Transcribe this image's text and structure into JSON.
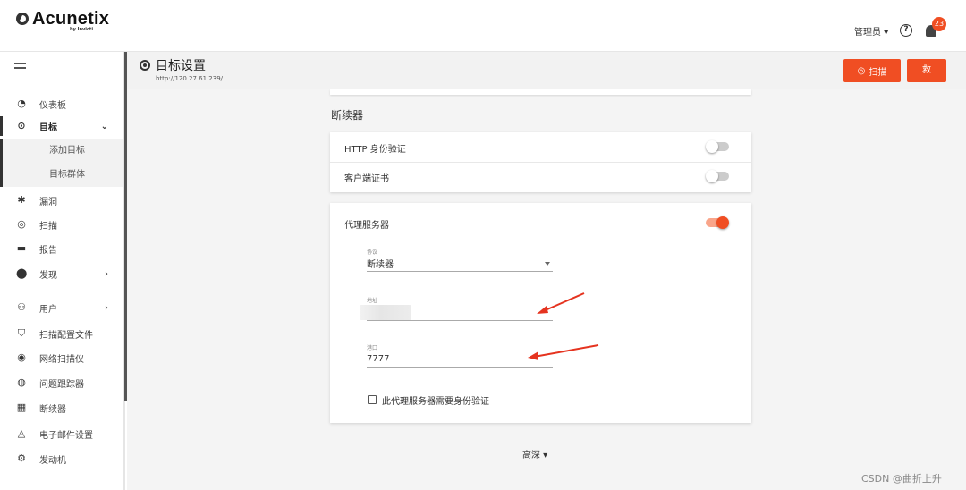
{
  "brand": {
    "name": "Acunetix",
    "sub": "by Invicti"
  },
  "header": {
    "user_label": "管理员 ▾",
    "help": "?",
    "notification_count": "23"
  },
  "sidebar": {
    "items": [
      {
        "label": "仪表板",
        "icon": "dashboard-icon",
        "glyph": "◔"
      },
      {
        "label": "目标",
        "icon": "target-icon",
        "glyph": "⊙",
        "chevron": "⌄"
      },
      {
        "label": "漏洞",
        "icon": "bug-icon",
        "glyph": "✱"
      },
      {
        "label": "扫描",
        "icon": "scan-icon",
        "glyph": "◎"
      },
      {
        "label": "报告",
        "icon": "report-icon",
        "glyph": "▬"
      },
      {
        "label": "发现",
        "icon": "compass-icon",
        "glyph": "⬤",
        "chevron": "›"
      },
      {
        "label": "用户",
        "icon": "users-icon",
        "glyph": "⚇",
        "chevron": "›"
      },
      {
        "label": "扫描配置文件",
        "icon": "shield-icon",
        "glyph": "⛉"
      },
      {
        "label": "网络扫描仪",
        "icon": "network-scanner-icon",
        "glyph": "◉"
      },
      {
        "label": "问题跟踪器",
        "icon": "issue-tracker-icon",
        "glyph": "◍"
      },
      {
        "label": "断续器",
        "icon": "proxy-icon",
        "glyph": "▦"
      },
      {
        "label": "电子邮件设置",
        "icon": "bell-icon",
        "glyph": "◬"
      },
      {
        "label": "发动机",
        "icon": "engine-icon",
        "glyph": "⚙"
      }
    ],
    "sub_items": [
      {
        "label": "添加目标"
      },
      {
        "label": "目标群体"
      }
    ]
  },
  "page": {
    "title": "目标设置",
    "url": "http://120.27.61.239/",
    "scan_button": "扫描",
    "save_button": "救"
  },
  "settings": {
    "section_title": "断续器",
    "http_auth_label": "HTTP 身份验证",
    "http_auth_enabled": false,
    "client_cert_label": "客户端证书",
    "client_cert_enabled": false,
    "proxy_label": "代理服务器",
    "proxy_enabled": true,
    "protocol_label": "协议",
    "protocol_value": "断续器",
    "address_label": "地址",
    "address_value": "",
    "port_label": "港口",
    "port_value": "7777",
    "proxy_auth_label": "此代理服务器需要身份验证",
    "proxy_auth_checked": false
  },
  "footer": {
    "advanced_label": "高深 ▾"
  },
  "watermark": "CSDN @曲折上升",
  "colors": {
    "accent": "#f04e23",
    "page_bg": "#f4f4f4",
    "header_bg": "#f2f2f2"
  }
}
